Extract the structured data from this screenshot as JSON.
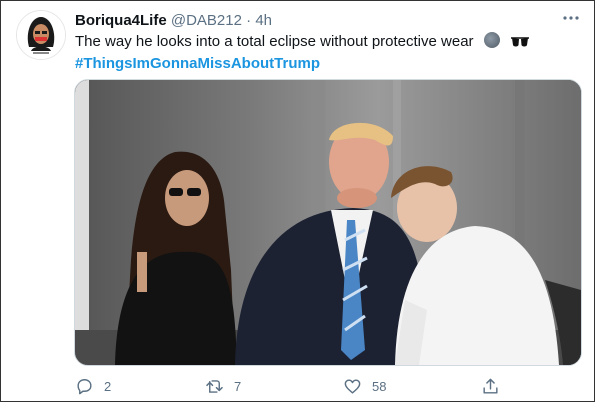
{
  "tweet": {
    "display_name": "Boriqua4Life",
    "handle": "@DAB212",
    "separator": "·",
    "time": "4h",
    "text": "The way he looks into a total eclipse without protective wear",
    "emojis": [
      "new-moon-emoji",
      "sunglasses-emoji"
    ],
    "hashtag": "#ThingsImGonnaMissAboutTrump",
    "image_alt": "Photo of four people on a balcony, a man in a suit and blue striped tie looking up toward the sky without glasses while a woman in sunglasses and a boy in a white shirt stand beside him"
  },
  "actions": {
    "reply_count": "2",
    "retweet_count": "7",
    "like_count": "58"
  },
  "colors": {
    "accent": "#1b95e0",
    "muted": "#5b7083",
    "text": "#0f1419"
  }
}
